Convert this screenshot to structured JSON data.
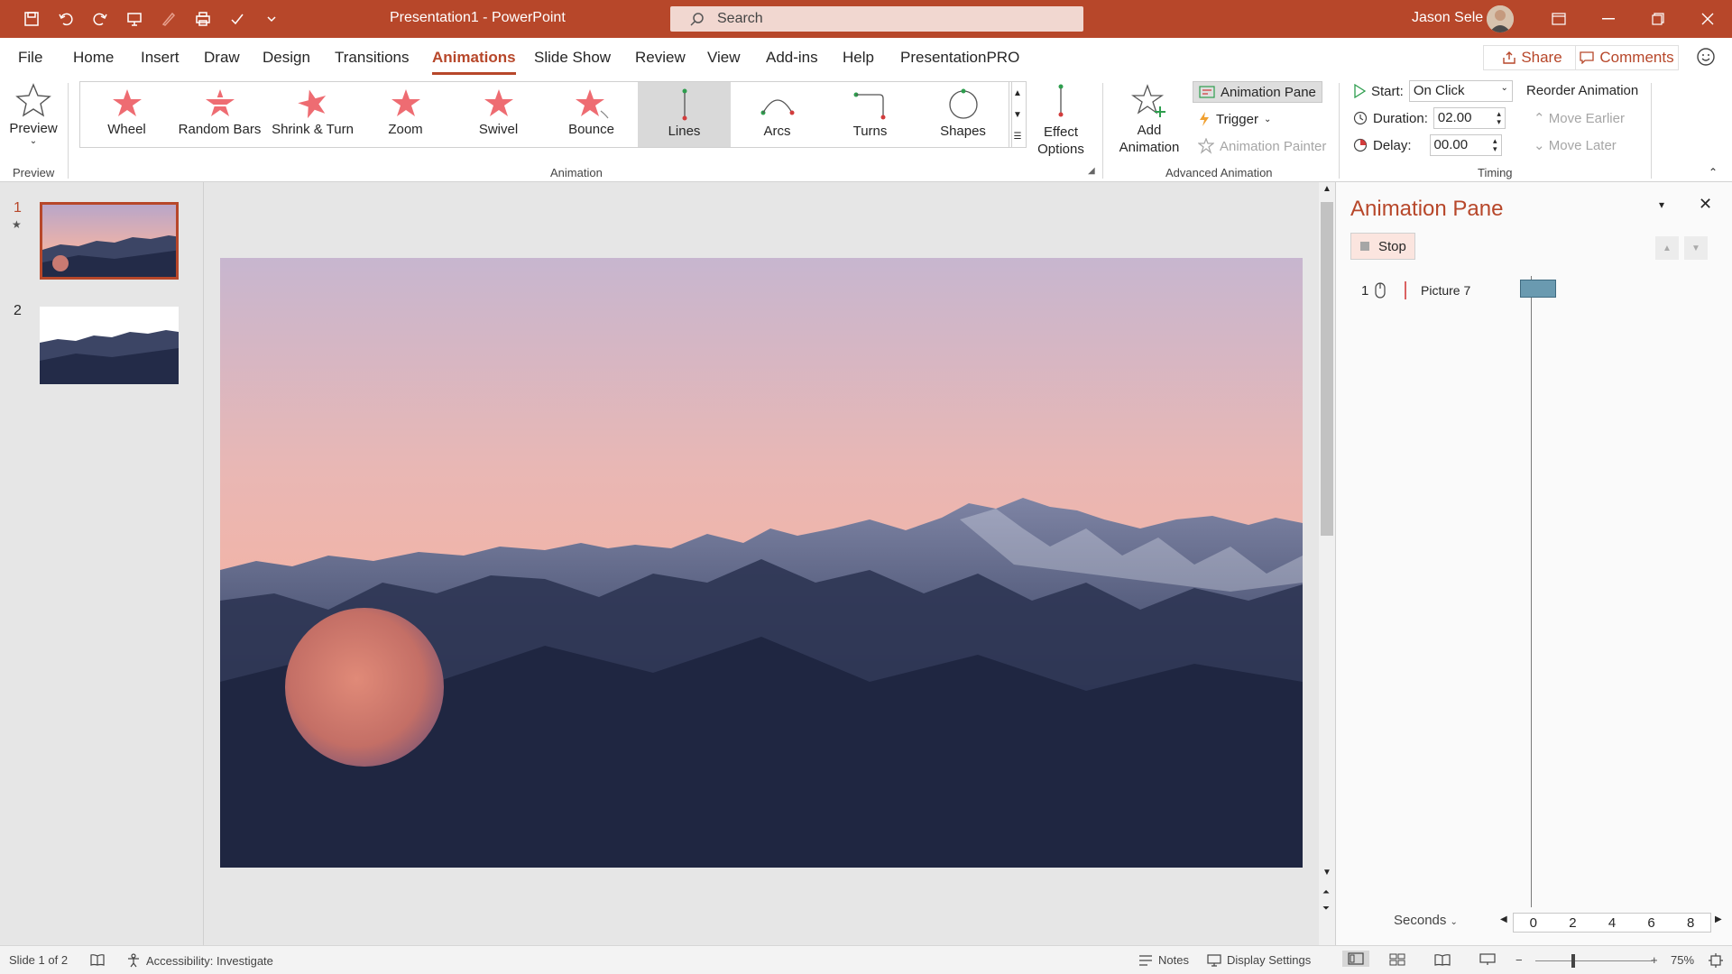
{
  "window": {
    "title": "Presentation1  -  PowerPoint",
    "search_placeholder": "Search",
    "user_name": "Jason Sele"
  },
  "tabs": [
    "File",
    "Home",
    "Insert",
    "Draw",
    "Design",
    "Transitions",
    "Animations",
    "Slide Show",
    "Review",
    "View",
    "Add-ins",
    "Help",
    "PresentationPRO"
  ],
  "active_tab": "Animations",
  "header_buttons": {
    "share": "Share",
    "comments": "Comments"
  },
  "ribbon": {
    "preview": {
      "label": "Preview",
      "group": "Preview"
    },
    "animation_group_label": "Animation",
    "gallery": [
      "Wheel",
      "Random Bars",
      "Shrink & Turn",
      "Zoom",
      "Swivel",
      "Bounce",
      "Lines",
      "Arcs",
      "Turns",
      "Shapes"
    ],
    "gallery_selected": "Lines",
    "effect_options": {
      "line1": "Effect",
      "line2": "Options"
    },
    "add_animation": {
      "line1": "Add",
      "line2": "Animation"
    },
    "advanced": {
      "group_label": "Advanced Animation",
      "animation_pane": "Animation Pane",
      "trigger": "Trigger",
      "animation_painter": "Animation Painter"
    },
    "timing": {
      "group_label": "Timing",
      "start_label": "Start:",
      "start_value": "On Click",
      "duration_label": "Duration:",
      "duration_value": "02.00",
      "delay_label": "Delay:",
      "delay_value": "00.00",
      "reorder_title": "Reorder Animation",
      "move_earlier": "Move Earlier",
      "move_later": "Move Later"
    }
  },
  "slides": [
    {
      "number": "1",
      "has_animation_star": "★"
    },
    {
      "number": "2"
    }
  ],
  "animation_pane": {
    "title": "Animation Pane",
    "stop": "Stop",
    "items": [
      {
        "order": "1",
        "name": "Picture 7"
      }
    ],
    "seconds_label": "Seconds",
    "ticks": [
      "0",
      "2",
      "4",
      "6",
      "8"
    ]
  },
  "statusbar": {
    "slide_info": "Slide 1 of 2",
    "accessibility": "Accessibility: Investigate",
    "notes": "Notes",
    "display_settings": "Display Settings",
    "zoom": "75%"
  },
  "colors": {
    "accent": "#b7472a",
    "ribbon_bg": "#ffffff",
    "workspace_bg": "#e6e6e6"
  }
}
